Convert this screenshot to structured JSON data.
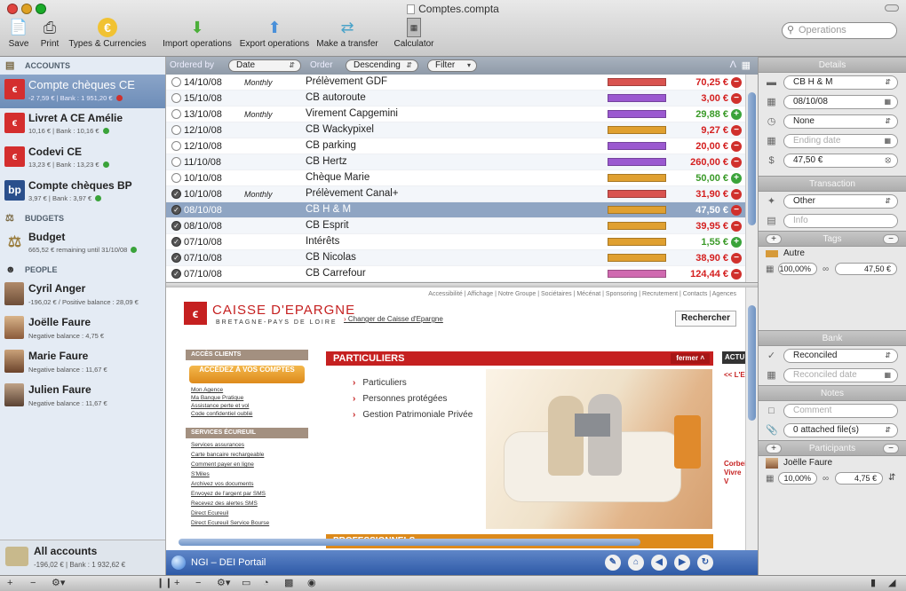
{
  "window": {
    "title": "Comptes.compta"
  },
  "toolbar": {
    "items": [
      {
        "label": "Save",
        "icon": "save-icon"
      },
      {
        "label": "Print",
        "icon": "print-icon"
      },
      {
        "label": "Types & Currencies",
        "icon": "currency-icon"
      },
      {
        "label": "Import operations",
        "icon": "import-icon"
      },
      {
        "label": "Export operations",
        "icon": "export-icon"
      },
      {
        "label": "Make a transfer",
        "icon": "transfer-icon"
      },
      {
        "label": "Calculator",
        "icon": "calculator-icon"
      }
    ],
    "search_placeholder": "Operations"
  },
  "sidebar": {
    "accounts_header": "ACCOUNTS",
    "accounts": [
      {
        "name": "Compte chèques CE",
        "sub": "-2 7,59 € | Bank : 1 951,20 €",
        "status": "red"
      },
      {
        "name": "Livret A CE Amélie",
        "sub": "10,16 € | Bank : 10,16 €",
        "status": "green"
      },
      {
        "name": "Codevi CE",
        "sub": "13,23 € | Bank : 13,23 €",
        "status": "green"
      },
      {
        "name": "Compte chèques BP",
        "sub": "3,97 € | Bank : 3,97 €",
        "status": "green"
      }
    ],
    "budgets_header": "BUDGETS",
    "budget": {
      "name": "Budget",
      "sub": "665,52 € remaining until 31/10/08",
      "status": "green"
    },
    "people_header": "PEOPLE",
    "people": [
      {
        "name": "Cyril Anger",
        "sub": "-196,02 € / Positive balance : 28,09 €"
      },
      {
        "name": "Joëlle Faure",
        "sub": "Negative balance : 4,75 €"
      },
      {
        "name": "Marie Faure",
        "sub": "Negative balance : 11,67 €"
      },
      {
        "name": "Julien Faure",
        "sub": "Negative balance : 11,67 €"
      }
    ],
    "all_accounts": {
      "name": "All accounts",
      "sub": "-196,02 € | Bank : 1 932,62 €"
    }
  },
  "filterbar": {
    "order_label": "Ordered by",
    "order_value": "Date",
    "sort_label": "Order",
    "sort_value": "Descending",
    "filter_value": "Filter"
  },
  "operations": [
    {
      "date": "14/10/08",
      "freq": "Monthly",
      "desc": "Prélèvement GDF",
      "amount": "70,25 €",
      "sign": "-",
      "checked": false,
      "color": "#d9534f"
    },
    {
      "date": "15/10/08",
      "freq": "",
      "desc": "CB autoroute",
      "amount": "3,00 €",
      "sign": "-",
      "checked": false,
      "color": "#9b59d0"
    },
    {
      "date": "13/10/08",
      "freq": "Monthly",
      "desc": "Virement Capgemini",
      "amount": "29,88 €",
      "sign": "+",
      "checked": false,
      "color": "#9b59d0"
    },
    {
      "date": "12/10/08",
      "freq": "",
      "desc": "CB Wackypixel",
      "amount": "9,27 €",
      "sign": "-",
      "checked": false,
      "color": "#e0a030"
    },
    {
      "date": "12/10/08",
      "freq": "",
      "desc": "CB parking",
      "amount": "20,00 €",
      "sign": "-",
      "checked": false,
      "color": "#9b59d0"
    },
    {
      "date": "11/10/08",
      "freq": "",
      "desc": "CB Hertz",
      "amount": "260,00 €",
      "sign": "-",
      "checked": false,
      "color": "#9b59d0"
    },
    {
      "date": "10/10/08",
      "freq": "",
      "desc": "Chèque Marie",
      "amount": "50,00 €",
      "sign": "+",
      "checked": false,
      "color": "#e0a030"
    },
    {
      "date": "10/10/08",
      "freq": "Monthly",
      "desc": "Prélèvement Canal+",
      "amount": "31,90 €",
      "sign": "-",
      "checked": true,
      "color": "#d9534f"
    },
    {
      "date": "08/10/08",
      "freq": "",
      "desc": "CB H & M",
      "amount": "47,50 €",
      "sign": "-",
      "checked": true,
      "color": "#e0a030",
      "selected": true
    },
    {
      "date": "08/10/08",
      "freq": "",
      "desc": "CB Esprit",
      "amount": "39,95 €",
      "sign": "-",
      "checked": true,
      "color": "#e0a030"
    },
    {
      "date": "07/10/08",
      "freq": "",
      "desc": "Intérêts",
      "amount": "1,55 €",
      "sign": "+",
      "checked": true,
      "color": "#e0a030"
    },
    {
      "date": "07/10/08",
      "freq": "",
      "desc": "CB Nicolas",
      "amount": "38,90 €",
      "sign": "-",
      "checked": true,
      "color": "#e0a030"
    },
    {
      "date": "07/10/08",
      "freq": "",
      "desc": "CB Carrefour",
      "amount": "124,44 €",
      "sign": "-",
      "checked": true,
      "color": "#d06ab0"
    }
  ],
  "web": {
    "top_nav": "Accessibilité | Affichage | Notre Groupe | Sociétaires | Mécénat | Sponsoring | Recrutement | Contacts | Agences",
    "bank_name": "CAISSE D'EPARGNE",
    "bank_region": "BRETAGNE-PAYS DE LOIRE",
    "change_link": "Changer de Caisse d'Epargne",
    "search_button": "Rechercher",
    "acces_header": "ACCÈS CLIENTS",
    "acces_button": "ACCÉDEZ À VOS COMPTES",
    "acces_links": [
      "Mon Agence",
      "Ma Banque Pratique",
      "Assistance perte et vol",
      "Code confidentiel oublié"
    ],
    "services_header": "SERVICES ÉCUREUIL",
    "services_links": [
      "Services assurances",
      "Carte bancaire rechargeable",
      "Comment payer en ligne",
      "S'Miles",
      "Archivez vos documents",
      "Envoyez de l'argent par SMS",
      "Recevez des alertes SMS",
      "Direct Ecureuil",
      "Direct Ecureuil Service Bourse"
    ],
    "particuliers_header": "PARTICULIERS",
    "fermer": "fermer",
    "particuliers_items": [
      "Particuliers",
      "Personnes protégées",
      "Gestion Patrimoniale Privée"
    ],
    "professionnels_header": "PROFESSIONNELS",
    "actu_header": "ACTU",
    "actu_text": "<< L'E",
    "actu_text2": "Corbei Vivre V"
  },
  "webbar": {
    "title": "NGI – DEI Portail"
  },
  "details": {
    "header": "Details",
    "payee": "CB H & M",
    "date": "08/10/08",
    "repeat": "None",
    "ending_date_placeholder": "Ending date",
    "amount": "47,50 €",
    "transaction_header": "Transaction",
    "type": "Other",
    "info_placeholder": "Info",
    "tags_header": "Tags",
    "tag_name": "Autre",
    "tag_percent": "100,00%",
    "tag_amount": "47,50 €",
    "bank_header": "Bank",
    "reconciled": "Reconciled",
    "reconciled_date_placeholder": "Reconciled date",
    "notes_header": "Notes",
    "comment_placeholder": "Comment",
    "attached": "0 attached file(s)",
    "participants_header": "Participants",
    "participant": "Joëlle Faure",
    "participant_percent": "10,00%",
    "participant_amount": "4,75 €"
  }
}
